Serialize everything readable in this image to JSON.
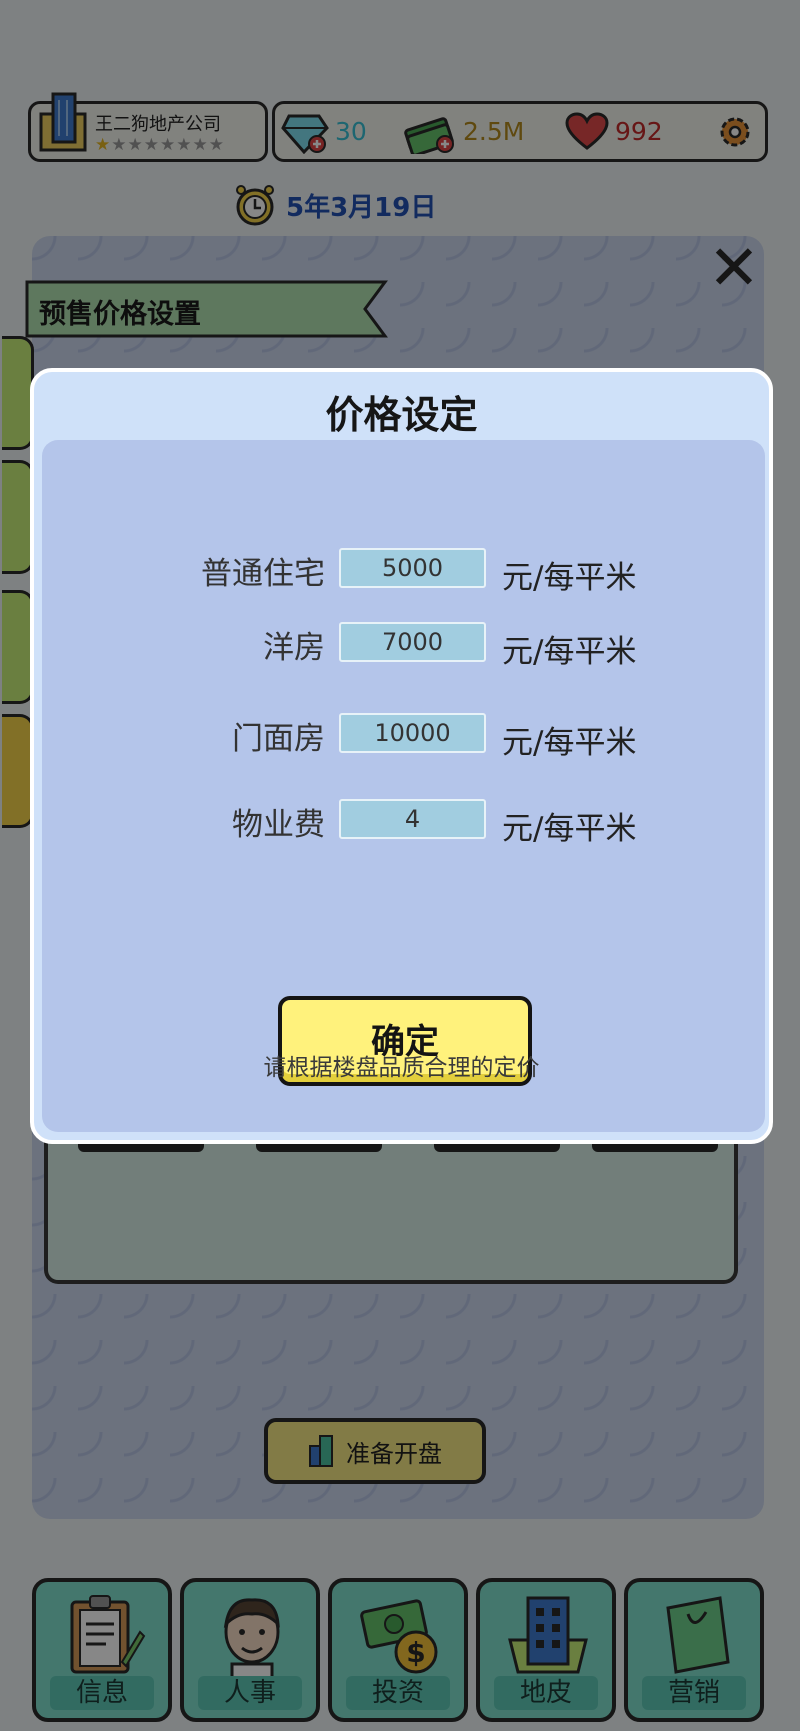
{
  "hud": {
    "company_name": "王二狗地产公司",
    "stars_filled": 1,
    "stars_total": 8,
    "gems": "30",
    "cash": "2.5M",
    "hearts": "992",
    "date": "5年3月19日"
  },
  "panel": {
    "title": "预售价格设置",
    "open_button": "准备开盘"
  },
  "dialog": {
    "title": "价格设定",
    "rows": [
      {
        "label": "普通住宅",
        "value": "5000",
        "unit": "元/每平米"
      },
      {
        "label": "洋房",
        "value": "7000",
        "unit": "元/每平米"
      },
      {
        "label": "门面房",
        "value": "10000",
        "unit": "元/每平米"
      },
      {
        "label": "物业费",
        "value": "4",
        "unit": "元/每平米"
      }
    ],
    "confirm": "确定",
    "hint": "请根据楼盘品质合理的定价"
  },
  "nav": [
    {
      "label": "信息",
      "icon": "clipboard-icon"
    },
    {
      "label": "人事",
      "icon": "person-icon"
    },
    {
      "label": "投资",
      "icon": "money-icon"
    },
    {
      "label": "地皮",
      "icon": "building-icon"
    },
    {
      "label": "营销",
      "icon": "shopping-bag-icon"
    }
  ],
  "colors": {
    "dialog_bg": "#cfe1f9",
    "dialog_body": "#b4c5ea",
    "field_bg": "#a1cde0",
    "confirm_bg": "#fff27c",
    "date": "#2352b4"
  }
}
